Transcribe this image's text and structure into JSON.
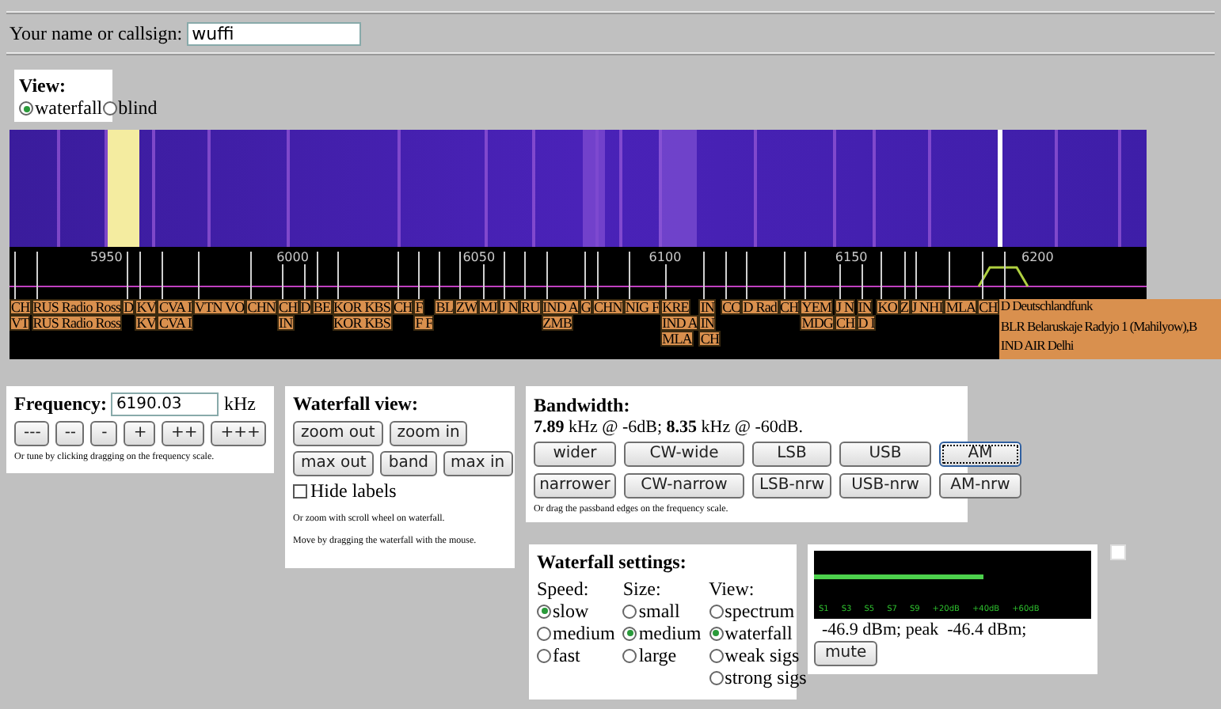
{
  "name_field": {
    "label": "Your name or callsign:",
    "value": "wuffi"
  },
  "view": {
    "title": "View:",
    "options": [
      {
        "label": "waterfall",
        "selected": true
      },
      {
        "label": "blind",
        "selected": false
      }
    ]
  },
  "scale": {
    "ticks": [
      "5950",
      "6000",
      "6050",
      "6100",
      "6150",
      "6200"
    ]
  },
  "stations": [
    {
      "lines": [
        "CH",
        "VT"
      ]
    },
    {
      "lines": [
        "RUS Radio Ross",
        "RUS Radio Ross"
      ]
    },
    {
      "lines": [
        "D"
      ]
    },
    {
      "lines": [
        "KV",
        "KV"
      ]
    },
    {
      "lines": [
        "CVA I",
        "CVA I"
      ]
    },
    {
      "lines": [
        "VTN VO"
      ]
    },
    {
      "lines": [
        "CHN"
      ]
    },
    {
      "lines": [
        "CH",
        "IN"
      ]
    },
    {
      "lines": [
        "D"
      ]
    },
    {
      "lines": [
        "BE"
      ]
    },
    {
      "lines": [
        "KOR KBS",
        "KOR KBS"
      ]
    },
    {
      "lines": [
        "CH"
      ]
    },
    {
      "lines": [
        "F",
        "F F"
      ]
    },
    {
      "lines": [
        "BL"
      ]
    },
    {
      "lines": [
        "ZW"
      ]
    },
    {
      "lines": [
        "MJ"
      ]
    },
    {
      "lines": [
        "J N"
      ]
    },
    {
      "lines": [
        "RU"
      ]
    },
    {
      "lines": [
        "IND A",
        "ZMB"
      ]
    },
    {
      "lines": [
        "G"
      ]
    },
    {
      "lines": [
        "CHN"
      ]
    },
    {
      "lines": [
        "NIG F"
      ]
    },
    {
      "lines": [
        "KRE",
        "IND A",
        "MLA"
      ]
    },
    {
      "lines": [
        "IN",
        "IN",
        "CH"
      ]
    },
    {
      "lines": [
        "CC"
      ]
    },
    {
      "lines": [
        "D Rad"
      ]
    },
    {
      "lines": [
        "CH"
      ]
    },
    {
      "lines": [
        "YEM",
        "MDG"
      ]
    },
    {
      "lines": [
        "J N",
        "CH"
      ]
    },
    {
      "lines": [
        "IN",
        "D I"
      ]
    },
    {
      "lines": [
        "KO"
      ]
    },
    {
      "lines": [
        "Z"
      ]
    },
    {
      "lines": [
        "J NHI"
      ]
    },
    {
      "lines": [
        "MLA"
      ]
    },
    {
      "lines": [
        "CH"
      ]
    },
    {
      "lines": [
        "D Deutschlandfunk",
        "BLR Belaruskaje Radyjo 1 (Mahilyow),B",
        "IND AIR Delhi"
      ]
    }
  ],
  "frequency": {
    "label": "Frequency:",
    "value": "6190.03",
    "unit": "kHz",
    "buttons": [
      "---",
      "--",
      "-",
      "+",
      "++",
      "+++"
    ],
    "hint": "Or tune by clicking dragging on the frequency scale."
  },
  "waterfall_view": {
    "title": "Waterfall view:",
    "button_rows": [
      [
        "zoom out",
        "zoom in"
      ],
      [
        "max out",
        "band",
        "max in"
      ]
    ],
    "hide_labels": {
      "label": "Hide labels",
      "checked": false
    },
    "hints": [
      "Or zoom with scroll wheel on waterfall.",
      "Move by dragging the waterfall with the mouse."
    ]
  },
  "bandwidth": {
    "title": "Bandwidth:",
    "reading": "**7.89** kHz @ -6dB; **8.35** kHz @ -60dB.",
    "buttons": [
      {
        "label": "wider",
        "selected": false
      },
      {
        "label": "CW-wide",
        "selected": false
      },
      {
        "label": "LSB",
        "selected": false
      },
      {
        "label": "USB",
        "selected": false
      },
      {
        "label": "AM",
        "selected": true
      },
      {
        "label": "narrower",
        "selected": false
      },
      {
        "label": "CW-narrow",
        "selected": false
      },
      {
        "label": "LSB-nrw",
        "selected": false
      },
      {
        "label": "USB-nrw",
        "selected": false
      },
      {
        "label": "AM-nrw",
        "selected": false
      }
    ],
    "hint": "Or drag the passband edges on the frequency scale."
  },
  "waterfall_settings": {
    "title": "Waterfall settings:",
    "groups": [
      {
        "label": "Speed:",
        "options": [
          {
            "label": "slow",
            "selected": true
          },
          {
            "label": "medium",
            "selected": false
          },
          {
            "label": "fast",
            "selected": false
          }
        ]
      },
      {
        "label": "Size:",
        "options": [
          {
            "label": "small",
            "selected": false
          },
          {
            "label": "medium",
            "selected": true
          },
          {
            "label": "large",
            "selected": false
          }
        ]
      },
      {
        "label": "View:",
        "options": [
          {
            "label": "spectrum",
            "selected": false
          },
          {
            "label": "waterfall",
            "selected": true
          },
          {
            "label": "weak sigs",
            "selected": false
          },
          {
            "label": "strong sigs",
            "selected": false
          }
        ]
      }
    ]
  },
  "smeter": {
    "level": 0.61,
    "scale": [
      "S1",
      "S3",
      "S5",
      "S7",
      "S9",
      "+20dB",
      "+40dB",
      "+60dB"
    ],
    "reading": "-46.9 dBm; peak  -46.4 dBm;",
    "button": "mute"
  },
  "side_checkbox": {
    "checked": false
  }
}
